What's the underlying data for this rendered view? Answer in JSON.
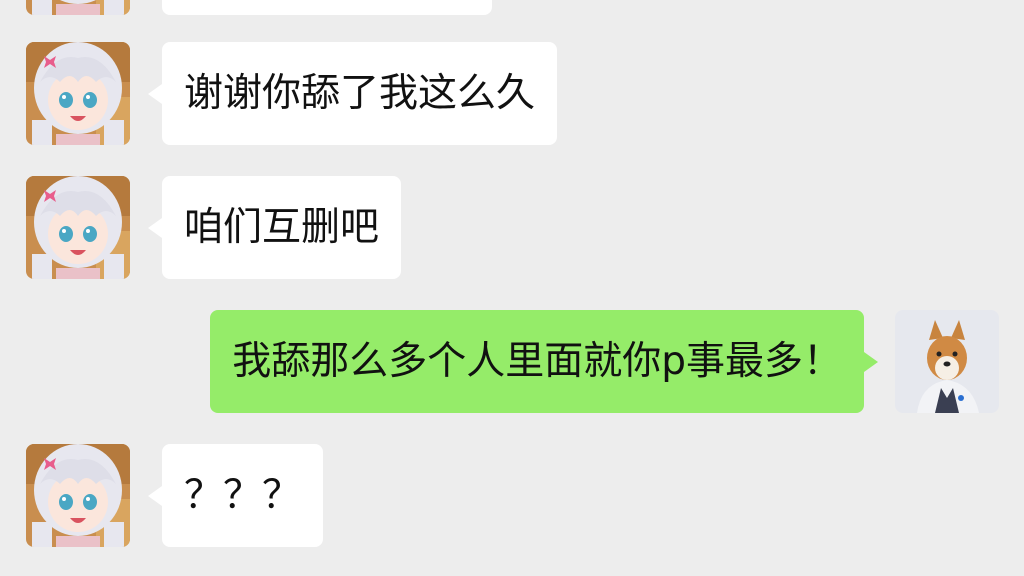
{
  "messages": [
    {
      "sender": "other",
      "text": ""
    },
    {
      "sender": "other",
      "text": "谢谢你舔了我这么久"
    },
    {
      "sender": "other",
      "text": "咱们互删吧"
    },
    {
      "sender": "self",
      "text": "我舔那么多个人里面就你p事最多！"
    },
    {
      "sender": "other",
      "text": "？？？"
    }
  ],
  "colors": {
    "background": "#ededed",
    "received_bubble": "#ffffff",
    "sent_bubble": "#95ec69"
  },
  "avatars": {
    "other": "anime-girl-avatar",
    "self": "shiba-dog-avatar"
  }
}
